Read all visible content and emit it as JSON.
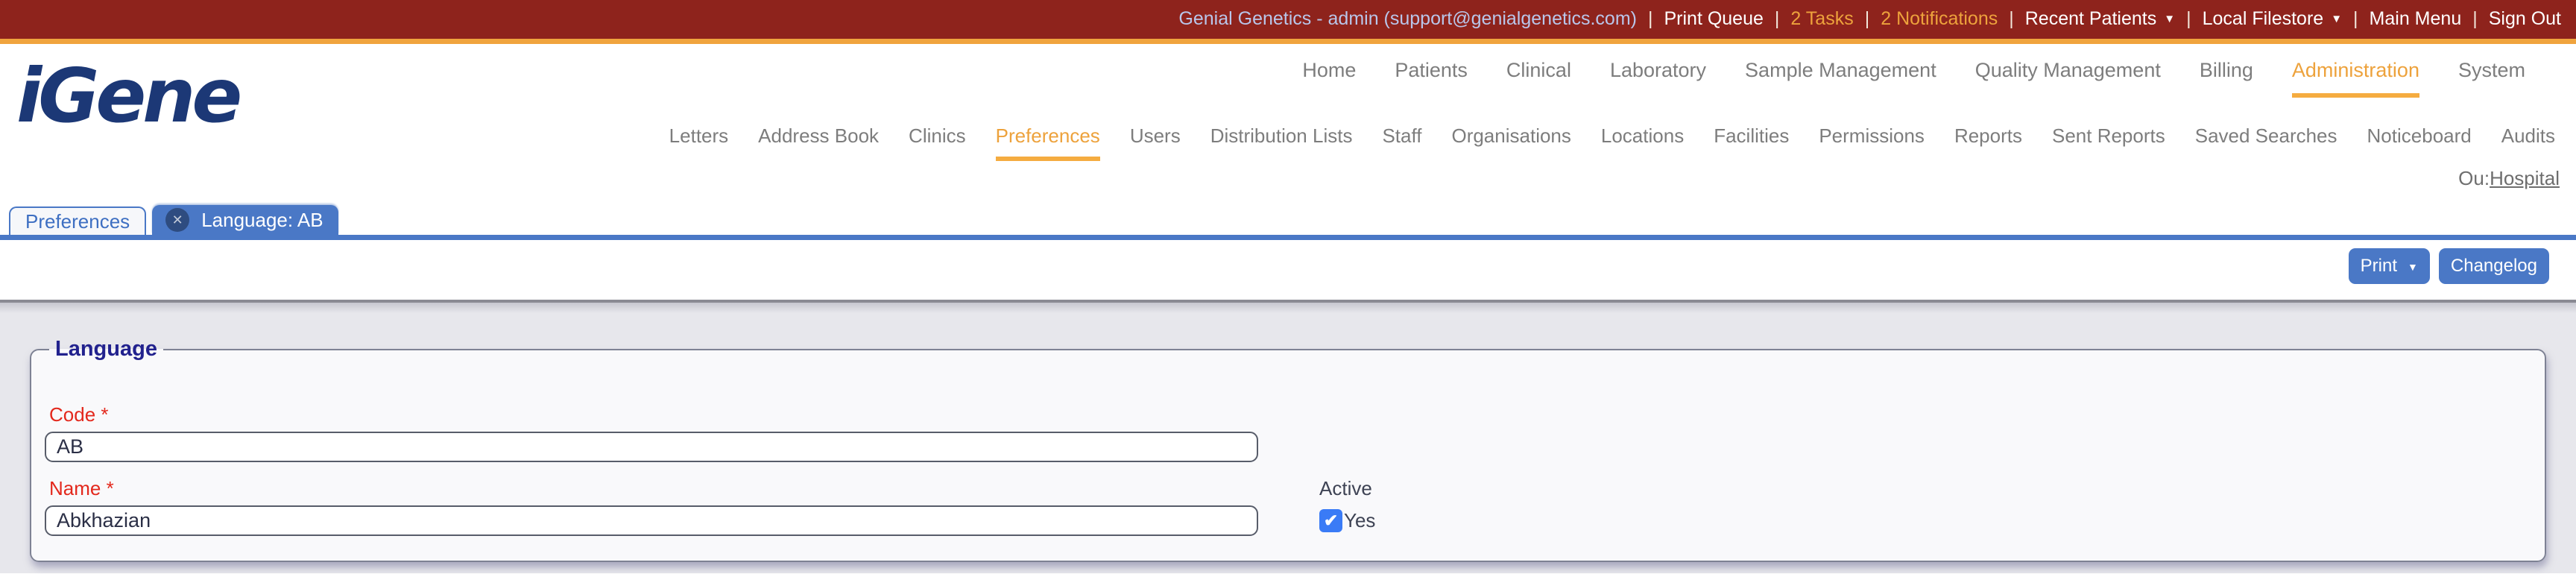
{
  "topbar": {
    "account": "Genial Genetics - admin (support@genialgenetics.com)",
    "separator": "|",
    "items": [
      {
        "label": "Print Queue",
        "style": "link"
      },
      {
        "label": "2 Tasks",
        "style": "alert"
      },
      {
        "label": "2 Notifications",
        "style": "alert"
      },
      {
        "label": "Recent Patients",
        "style": "link",
        "dropdown": true
      },
      {
        "label": "Local Filestore",
        "style": "link",
        "dropdown": true
      },
      {
        "label": "Main Menu",
        "style": "link"
      },
      {
        "label": "Sign Out",
        "style": "link"
      }
    ]
  },
  "logo_text": "iGene",
  "main_nav": [
    {
      "label": "Home"
    },
    {
      "label": "Patients"
    },
    {
      "label": "Clinical"
    },
    {
      "label": "Laboratory"
    },
    {
      "label": "Sample Management"
    },
    {
      "label": "Quality Management"
    },
    {
      "label": "Billing"
    },
    {
      "label": "Administration",
      "active": true
    },
    {
      "label": "System"
    }
  ],
  "sub_nav": [
    {
      "label": "Letters"
    },
    {
      "label": "Address Book"
    },
    {
      "label": "Clinics"
    },
    {
      "label": "Preferences",
      "active": true
    },
    {
      "label": "Users"
    },
    {
      "label": "Distribution Lists"
    },
    {
      "label": "Staff"
    },
    {
      "label": "Organisations"
    },
    {
      "label": "Locations"
    },
    {
      "label": "Facilities"
    },
    {
      "label": "Permissions"
    },
    {
      "label": "Reports"
    },
    {
      "label": "Sent Reports"
    },
    {
      "label": "Saved Searches"
    },
    {
      "label": "Noticeboard"
    },
    {
      "label": "Audits"
    }
  ],
  "ou": {
    "prefix": "Ou:",
    "link": "Hospital"
  },
  "tabs": [
    {
      "label": "Preferences",
      "active": false,
      "closable": false
    },
    {
      "label": "Language: AB",
      "active": true,
      "closable": true
    }
  ],
  "actions": {
    "print": "Print",
    "changelog": "Changelog"
  },
  "form": {
    "legend": "Language",
    "code": {
      "label": "Code *",
      "value": "AB"
    },
    "name": {
      "label": "Name *",
      "value": "Abkhazian"
    },
    "active": {
      "label": "Active",
      "option": "Yes",
      "checked": true
    }
  },
  "icons": {
    "caret_down": "▼",
    "close": "✕",
    "check": "✔"
  },
  "colors": {
    "topbar_red": "#8E231C",
    "accent_orange": "#F0A43E",
    "accent_blue": "#4A78C6",
    "logo_navy": "#1C3876",
    "legend_blue": "#22228E",
    "label_red": "#E3281C",
    "checkbox_blue": "#3A7BF6",
    "nav_gray": "#7D7D7D"
  }
}
